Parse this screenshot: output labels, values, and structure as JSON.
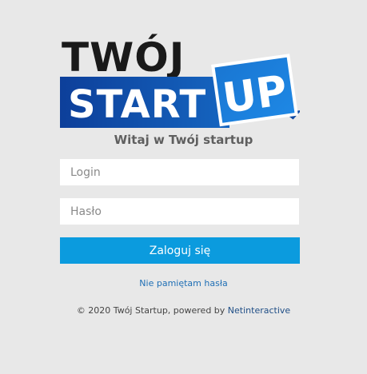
{
  "logo": {
    "line1": "TWÓJ",
    "line2": "START",
    "badge": "UP",
    "colors": {
      "dark": "#1a1a1a",
      "blue_dark": "#0d3f9a",
      "blue_mid": "#1565c0",
      "blue_light": "#1e88e5"
    }
  },
  "welcome": "Witaj w Twój startup",
  "form": {
    "login_placeholder": "Login",
    "password_placeholder": "Hasło",
    "submit_label": "Zaloguj się"
  },
  "forgot_password": "Nie pamiętam hasła",
  "footer": {
    "prefix": "© 2020 Twój Startup, powered by ",
    "link": "Netinteractive"
  },
  "colors": {
    "background": "#e8e8e8",
    "button": "#0b9bde",
    "link": "#1f6fb5"
  }
}
